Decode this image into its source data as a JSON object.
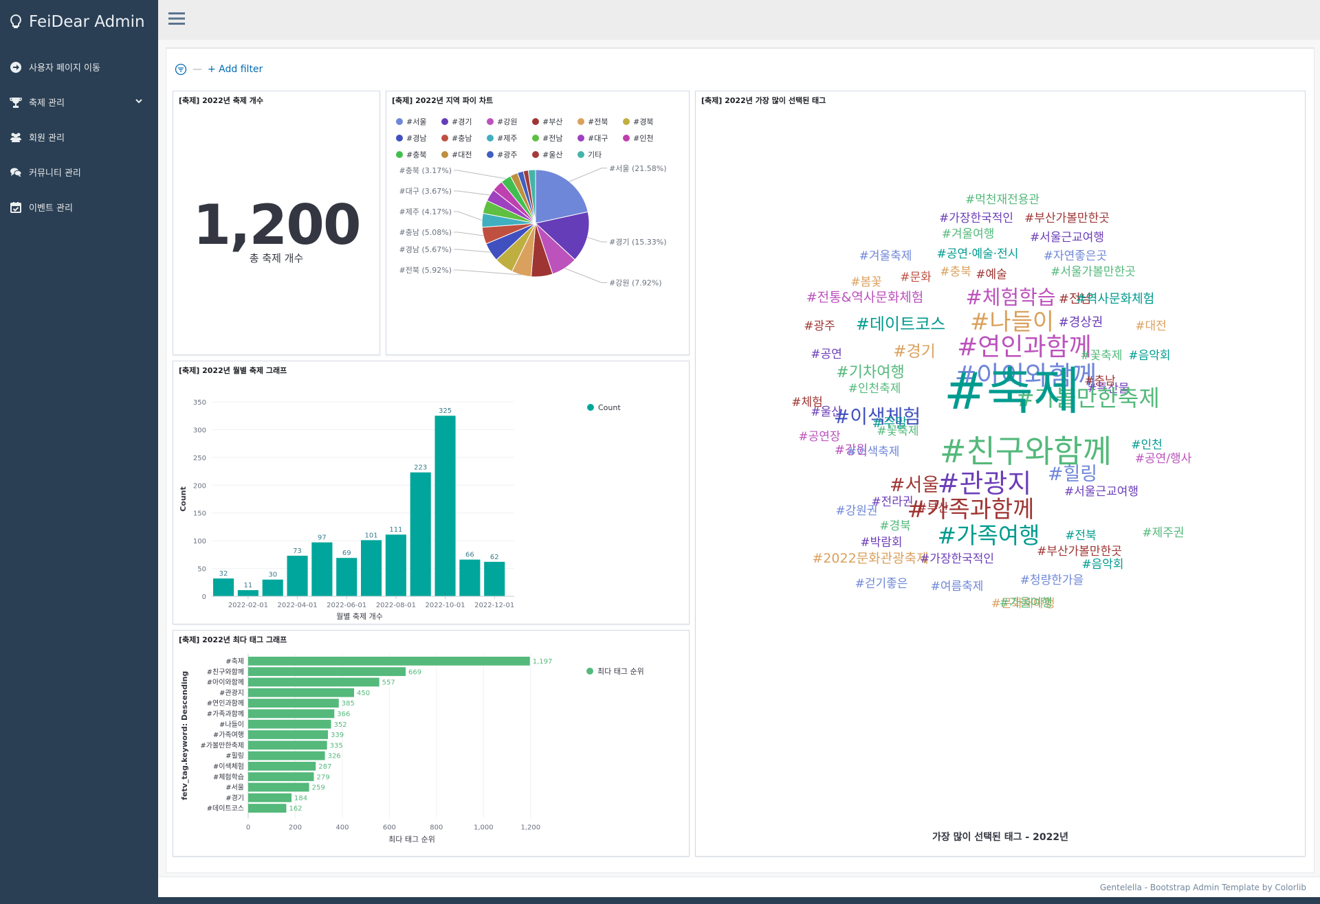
{
  "app": {
    "brand": "FeiDear Admin"
  },
  "sidebar": {
    "items": [
      {
        "label": "사용자 페이지 이동",
        "icon": "arrow-circle-right-icon"
      },
      {
        "label": "축제 관리",
        "icon": "trophy-icon",
        "has_submenu": true
      },
      {
        "label": "회원 관리",
        "icon": "users-icon"
      },
      {
        "label": "커뮤니티 관리",
        "icon": "comments-icon"
      },
      {
        "label": "이벤트 관리",
        "icon": "calendar-check-icon"
      }
    ]
  },
  "filter": {
    "add_label": "+ Add filter",
    "separator": "—"
  },
  "panels": {
    "metric": {
      "title": "[축제] 2022년 축제 개수",
      "value": "1,200",
      "label": "총 축제 개수"
    },
    "pie": {
      "title": "[축제] 2022년 지역 파이 차트"
    },
    "monthly": {
      "title": "[축제] 2022년 월별 축제 그래프"
    },
    "tags": {
      "title": "[축제] 2022년 최다 태그 그래프"
    },
    "cloud": {
      "title": "[축제] 2022년 가장 많이 선택된 태그",
      "caption": "가장 많이 선택된 태그 - 2022년"
    }
  },
  "footer": {
    "text": "Gentelella - Bootstrap Admin Template by Colorlib"
  },
  "chart_data": [
    {
      "type": "pie",
      "title": "[축제] 2022년 지역 파이 차트",
      "legend": [
        "#서울",
        "#경기",
        "#강원",
        "#부산",
        "#전북",
        "#경북",
        "#경남",
        "#충남",
        "#제주",
        "#전남",
        "#대구",
        "#인천",
        "#충북",
        "#대전",
        "#광주",
        "#울산",
        "기타"
      ],
      "legend_colors": [
        "#6f87d8",
        "#663db8",
        "#bc52bc",
        "#9e3533",
        "#daa05d",
        "#bfaf40",
        "#4050bf",
        "#bf5040",
        "#40afbf",
        "#5fbf40",
        "#9f40bf",
        "#bf40af",
        "#40bf50",
        "#bf8f40",
        "#4060bf",
        "#a33b3b",
        "#45b4a8"
      ],
      "slices": [
        {
          "label": "#서울",
          "value": 21.58,
          "color": "#6f87d8",
          "annot": "#서울 (21.58%)"
        },
        {
          "label": "#경기",
          "value": 15.33,
          "color": "#663db8",
          "annot": "#경기 (15.33%)"
        },
        {
          "label": "#강원",
          "value": 7.92,
          "color": "#bc52bc",
          "annot": "#강원 (7.92%)"
        },
        {
          "label": "#부산",
          "value": 6.5,
          "color": "#9e3533",
          "annot": ""
        },
        {
          "label": "#전북",
          "value": 5.92,
          "color": "#daa05d",
          "annot": "#전북 (5.92%)"
        },
        {
          "label": "#경북",
          "value": 5.8,
          "color": "#bfaf40",
          "annot": ""
        },
        {
          "label": "#경남",
          "value": 5.67,
          "color": "#4050bf",
          "annot": "#경남 (5.67%)"
        },
        {
          "label": "#충남",
          "value": 5.08,
          "color": "#bf5040",
          "annot": "#충남 (5.08%)"
        },
        {
          "label": "#제주",
          "value": 4.17,
          "color": "#40afbf",
          "annot": "#제주 (4.17%)"
        },
        {
          "label": "#전남",
          "value": 4.0,
          "color": "#5fbf40",
          "annot": ""
        },
        {
          "label": "#대구",
          "value": 3.67,
          "color": "#9f40bf",
          "annot": "#대구 (3.67%)"
        },
        {
          "label": "#인천",
          "value": 3.4,
          "color": "#bf40af",
          "annot": ""
        },
        {
          "label": "#충북",
          "value": 3.17,
          "color": "#40bf50",
          "annot": "#충북 (3.17%)"
        },
        {
          "label": "#대전",
          "value": 2.3,
          "color": "#bf8f40",
          "annot": ""
        },
        {
          "label": "#광주",
          "value": 1.8,
          "color": "#4060bf",
          "annot": ""
        },
        {
          "label": "#울산",
          "value": 1.5,
          "color": "#a33b3b",
          "annot": ""
        },
        {
          "label": "기타",
          "value": 2.19,
          "color": "#45b4a8",
          "annot": ""
        }
      ]
    },
    {
      "type": "bar",
      "title": "[축제] 2022년 월별 축제 그래프",
      "xlabel": "월별 축제 개수",
      "ylabel": "Count",
      "series_name": "Count",
      "color": "#00a69b",
      "ylim": [
        0,
        350
      ],
      "yticks": [
        0,
        50,
        100,
        150,
        200,
        250,
        300,
        350
      ],
      "values": [
        32,
        11,
        30,
        73,
        97,
        69,
        101,
        111,
        223,
        325,
        66,
        62
      ],
      "xtick_labels": [
        "2022-02-01",
        "2022-04-01",
        "2022-06-01",
        "2022-08-01",
        "2022-10-01",
        "2022-12-01"
      ]
    },
    {
      "type": "bar",
      "orientation": "horizontal",
      "title": "[축제] 2022년 최다 태그 그래프",
      "xlabel": "최다 태그 순위",
      "ylabel": "fetv_tag.keyword: Descending",
      "series_name": "최다 태그 순위",
      "color": "#54b97b",
      "xlim": [
        0,
        1300
      ],
      "xticks": [
        "0",
        "200",
        "400",
        "600",
        "800",
        "1,000",
        "1,200"
      ],
      "categories": [
        "#축제",
        "#친구와함께",
        "#아이와함께",
        "#관광지",
        "#연인과함께",
        "#가족과함께",
        "#나들이",
        "#가족여행",
        "#가볼만한축제",
        "#힐링",
        "#이색체험",
        "#체험학습",
        "#서울",
        "#경기",
        "#데이트코스"
      ],
      "values": [
        1197,
        669,
        557,
        450,
        385,
        366,
        352,
        339,
        335,
        326,
        287,
        279,
        259,
        184,
        162
      ],
      "value_labels": [
        "1,197",
        "669",
        "557",
        "450",
        "385",
        "366",
        "352",
        "339",
        "335",
        "326",
        "287",
        "279",
        "259",
        "184",
        "162"
      ]
    }
  ],
  "word_cloud": [
    {
      "text": "#먹천재전용관",
      "color": "#54b97b",
      "size": 17
    },
    {
      "text": "#가장한국적인",
      "color": "#6b3db8",
      "size": 17
    },
    {
      "text": "#부산가볼만한곳",
      "color": "#9e3533",
      "size": 17
    },
    {
      "text": "#겨울여행",
      "color": "#54b97b",
      "size": 17
    },
    {
      "text": "#서울근교여행",
      "color": "#6b3db8",
      "size": 17
    },
    {
      "text": "#겨울축제",
      "color": "#6f87d8",
      "size": 17
    },
    {
      "text": "#공연·예술·전시",
      "color": "#009b8f",
      "size": 17
    },
    {
      "text": "#자연좋은곳",
      "color": "#6f87d8",
      "size": 17
    },
    {
      "text": "#충북",
      "color": "#daa05d",
      "size": 17
    },
    {
      "text": "#문화",
      "color": "#bf5040",
      "size": 17
    },
    {
      "text": "#예술",
      "color": "#9e3533",
      "size": 17
    },
    {
      "text": "#서울가볼만한곳",
      "color": "#54b97b",
      "size": 17
    },
    {
      "text": "#봄꽃",
      "color": "#daa05d",
      "size": 17
    },
    {
      "text": "#전통&역사문화체험",
      "color": "#bc52bc",
      "size": 19
    },
    {
      "text": "#체험학습",
      "color": "#bc52bc",
      "size": 29
    },
    {
      "text": "#전남",
      "color": "#9e3533",
      "size": 18
    },
    {
      "text": "#역사문화체험",
      "color": "#009b8f",
      "size": 18
    },
    {
      "text": "#광주",
      "color": "#9e3533",
      "size": 17
    },
    {
      "text": "#데이트코스",
      "color": "#009b8f",
      "size": 24
    },
    {
      "text": "#나들이",
      "color": "#daa05d",
      "size": 34
    },
    {
      "text": "#경상권",
      "color": "#6b3db8",
      "size": 18
    },
    {
      "text": "#대전",
      "color": "#daa05d",
      "size": 17
    },
    {
      "text": "#공연",
      "color": "#6b3db8",
      "size": 17
    },
    {
      "text": "#경기",
      "color": "#daa05d",
      "size": 23
    },
    {
      "text": "#연인과함께",
      "color": "#bc52bc",
      "size": 36
    },
    {
      "text": "#꽃축제",
      "color": "#54b97b",
      "size": 17
    },
    {
      "text": "#음악회",
      "color": "#009b8f",
      "size": 17
    },
    {
      "text": "#기차여행",
      "color": "#54b97b",
      "size": 22
    },
    {
      "text": "#아이와함께",
      "color": "#6f87d8",
      "size": 38
    },
    {
      "text": "#충남",
      "color": "#9e3533",
      "size": 17
    },
    {
      "text": "#인천축제",
      "color": "#54b97b",
      "size": 17
    },
    {
      "text": "#특산물",
      "color": "#6b3db8",
      "size": 17
    },
    {
      "text": "#체험",
      "color": "#9e3533",
      "size": 17
    },
    {
      "text": "#가볼만한축제",
      "color": "#54b97b",
      "size": 33
    },
    {
      "text": "#축제",
      "color": "#009b8f",
      "size": 74
    },
    {
      "text": "#울산",
      "color": "#6b3db8",
      "size": 17
    },
    {
      "text": "#이색체험",
      "color": "#4050bf",
      "size": 28
    },
    {
      "text": "#주말",
      "color": "#009b8f",
      "size": 19
    },
    {
      "text": "#꽃축제",
      "color": "#54b97b",
      "size": 17
    },
    {
      "text": "#공연장",
      "color": "#bc52bc",
      "size": 17
    },
    {
      "text": "#강원",
      "color": "#bc52bc",
      "size": 18
    },
    {
      "text": "#인천",
      "color": "#009b8f",
      "size": 17
    },
    {
      "text": "#이색축제",
      "color": "#6f87d8",
      "size": 17
    },
    {
      "text": "#친구와함께",
      "color": "#54b97b",
      "size": 46
    },
    {
      "text": "#공연/행사",
      "color": "#bc52bc",
      "size": 17
    },
    {
      "text": "#힐링",
      "color": "#6f87d8",
      "size": 27
    },
    {
      "text": "#서울",
      "color": "#9e3533",
      "size": 27
    },
    {
      "text": "#관광지",
      "color": "#6b3db8",
      "size": 38
    },
    {
      "text": "#서울근교여행",
      "color": "#6b3db8",
      "size": 17
    },
    {
      "text": "#전라권",
      "color": "#6b3db8",
      "size": 17
    },
    {
      "text": "#부산",
      "color": "#9e3533",
      "size": 17
    },
    {
      "text": "#강원권",
      "color": "#6f87d8",
      "size": 17
    },
    {
      "text": "#가족과함께",
      "color": "#9e3533",
      "size": 34
    },
    {
      "text": "#경북",
      "color": "#54b97b",
      "size": 17
    },
    {
      "text": "#제주권",
      "color": "#54b97b",
      "size": 17
    },
    {
      "text": "#박람회",
      "color": "#6b3db8",
      "size": 17
    },
    {
      "text": "#가족여행",
      "color": "#009b8f",
      "size": 33
    },
    {
      "text": "#전북",
      "color": "#009b8f",
      "size": 17
    },
    {
      "text": "#2022문화관광축제",
      "color": "#daa05d",
      "size": 19
    },
    {
      "text": "#가장한국적인",
      "color": "#6b3db8",
      "size": 17
    },
    {
      "text": "#부산가볼만한곳",
      "color": "#9e3533",
      "size": 17
    },
    {
      "text": "#음악회",
      "color": "#009b8f",
      "size": 17
    },
    {
      "text": "#걷기좋은",
      "color": "#6f87d8",
      "size": 17
    },
    {
      "text": "#여름축제",
      "color": "#6f87d8",
      "size": 17
    },
    {
      "text": "#청량한가을",
      "color": "#6f87d8",
      "size": 17
    },
    {
      "text": "#문화재야행",
      "color": "#daa05d",
      "size": 17
    },
    {
      "text": "#가을여행",
      "color": "#54b97b",
      "size": 17
    }
  ]
}
